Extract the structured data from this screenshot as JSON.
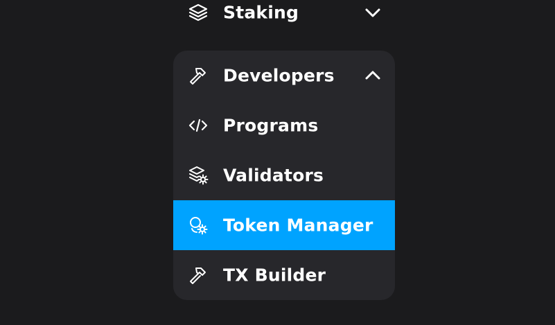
{
  "nav": {
    "staking": {
      "label": "Staking",
      "icon": "layers-icon",
      "chevron": "chevron-down-icon"
    },
    "developers": {
      "label": "Developers",
      "icon": "hammer-icon",
      "chevron": "chevron-up-icon",
      "items": [
        {
          "label": "Programs",
          "icon": "code-icon"
        },
        {
          "label": "Validators",
          "icon": "server-gear-icon"
        },
        {
          "label": "Token Manager",
          "icon": "coins-gear-icon",
          "active": true
        },
        {
          "label": "TX Builder",
          "icon": "hammer-icon"
        }
      ]
    }
  },
  "colors": {
    "background": "#1b1b1d",
    "panel": "#27272b",
    "active": "#00a3ff",
    "text": "#ffffff"
  }
}
